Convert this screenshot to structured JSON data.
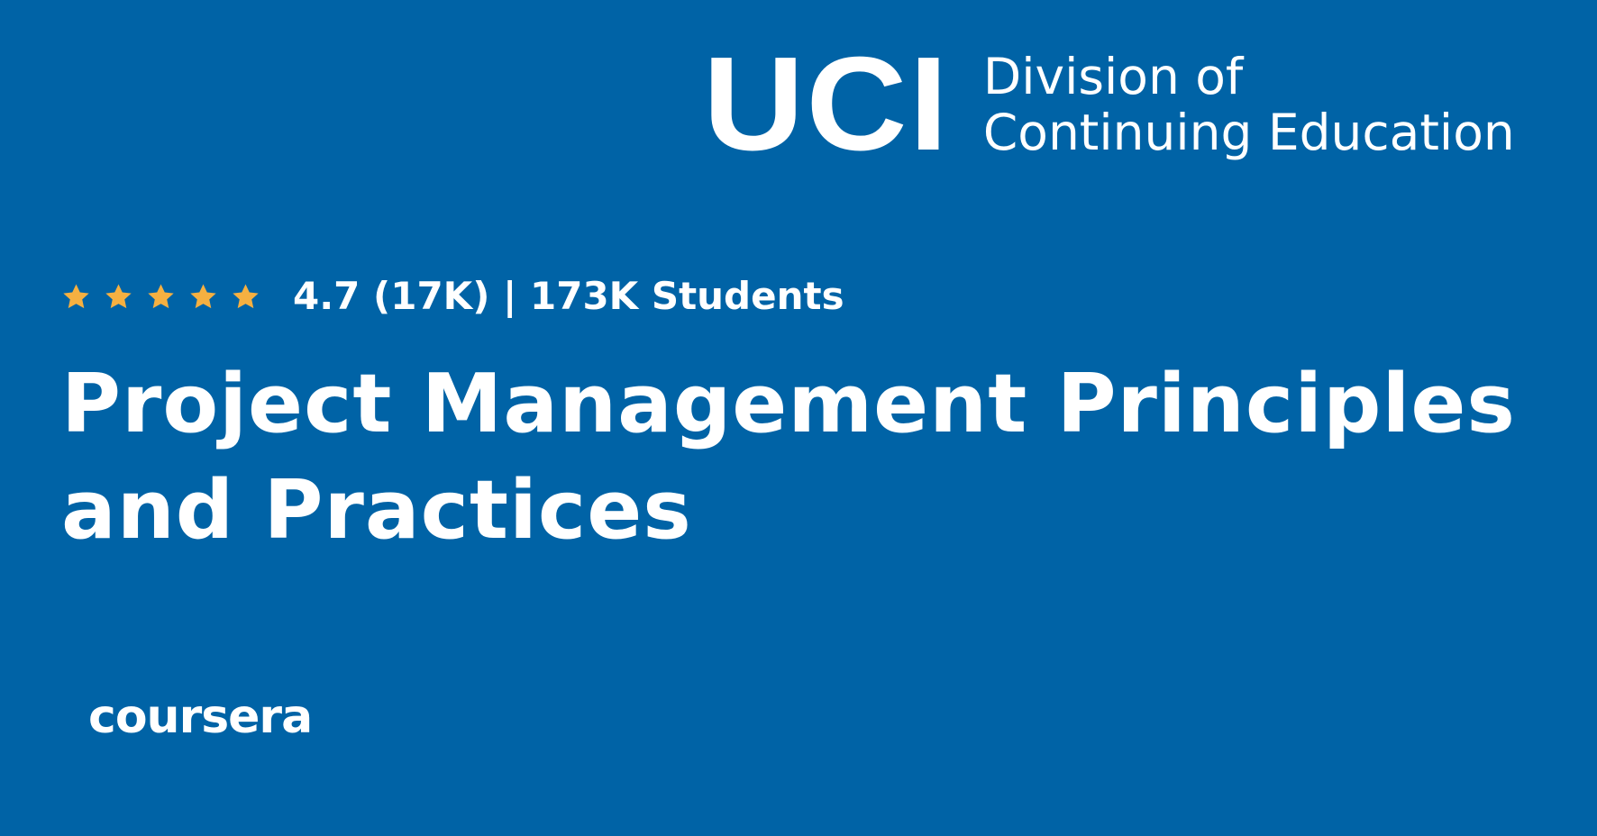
{
  "institution": {
    "logo_mark": "UCI",
    "name_line1": "Division of",
    "name_line2": "Continuing Education"
  },
  "rating": {
    "stars": 5,
    "star_color": "#f5b041",
    "summary": "4.7 (17K) | 173K Students"
  },
  "course": {
    "title_line1": "Project Management Principles",
    "title_line2": "and Practices"
  },
  "provider": {
    "logo_text": "coursera"
  },
  "colors": {
    "background": "#0063a6",
    "text": "#ffffff"
  }
}
